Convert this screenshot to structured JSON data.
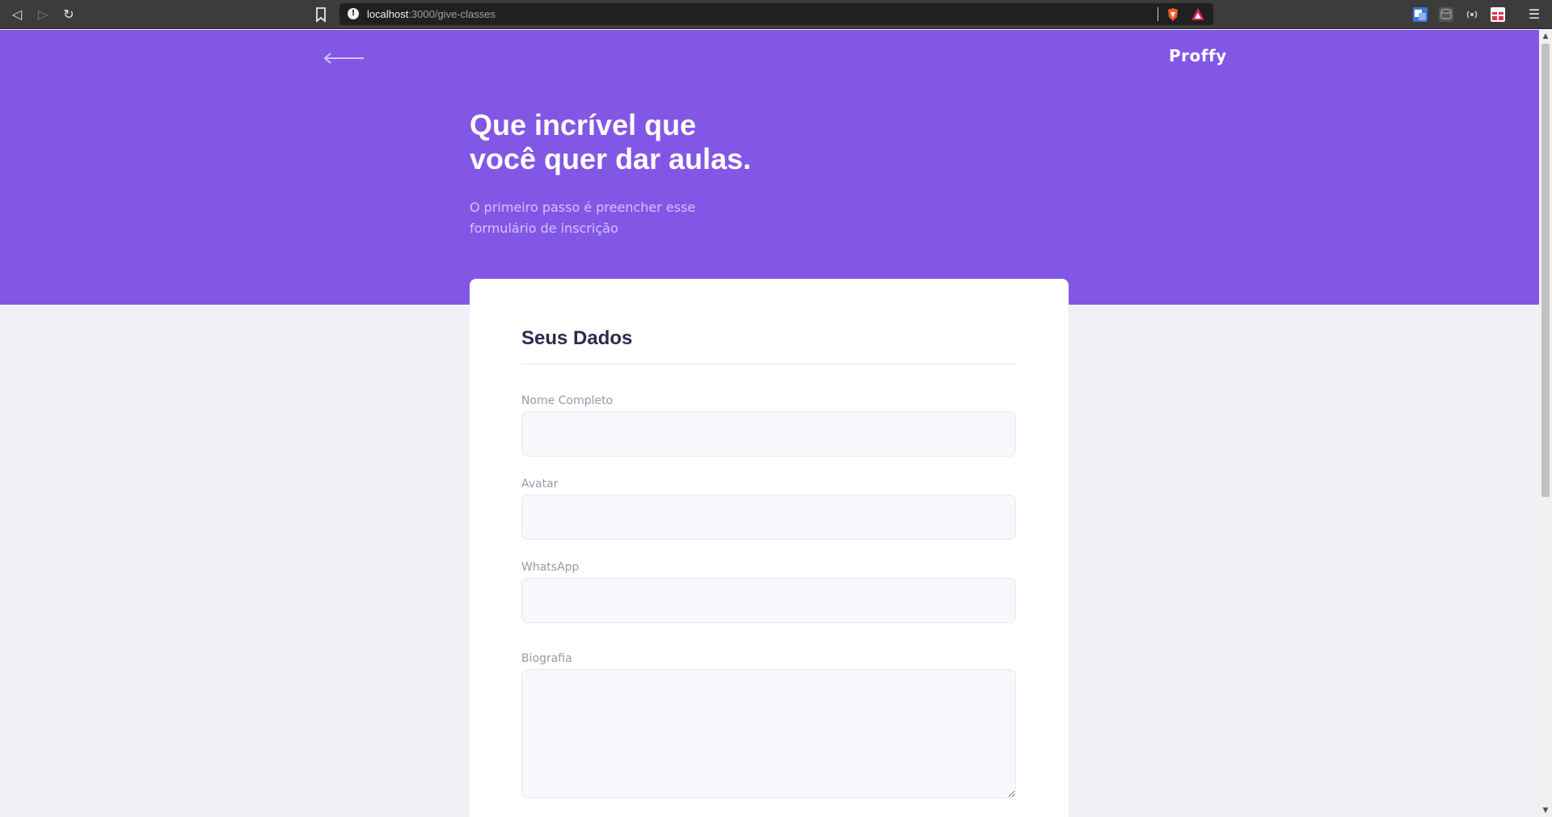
{
  "browser": {
    "back_glyph": "◁",
    "forward_glyph": "▷",
    "reload_glyph": "↻",
    "menu_glyph": "☰",
    "url_host": "localhost",
    "url_path": ":3000/give-classes",
    "url_info_glyph": "!",
    "scroll_up_glyph": "▲",
    "scroll_down_glyph": "▼"
  },
  "header": {
    "back_icon": "arrow-left-icon",
    "logo_text": "Proffy"
  },
  "hero": {
    "title_line1": "Que incrível que",
    "title_line2": "você quer dar aulas.",
    "subtitle_line1": "O primeiro passo é preencher esse",
    "subtitle_line2": "formulário de inscrição"
  },
  "form": {
    "fieldset_title": "Seus Dados",
    "name_label": "Nome Completo",
    "name_value": "",
    "avatar_label": "Avatar",
    "avatar_value": "",
    "whatsapp_label": "WhatsApp",
    "whatsapp_value": "",
    "bio_label": "Biografia",
    "bio_value": ""
  },
  "colors": {
    "primary": "#8257e5",
    "background": "#f0f0f7",
    "title_dark": "#32264d",
    "label": "#9c98a6",
    "input_bg": "#f8f8fc",
    "input_border": "#e6e6f0"
  }
}
